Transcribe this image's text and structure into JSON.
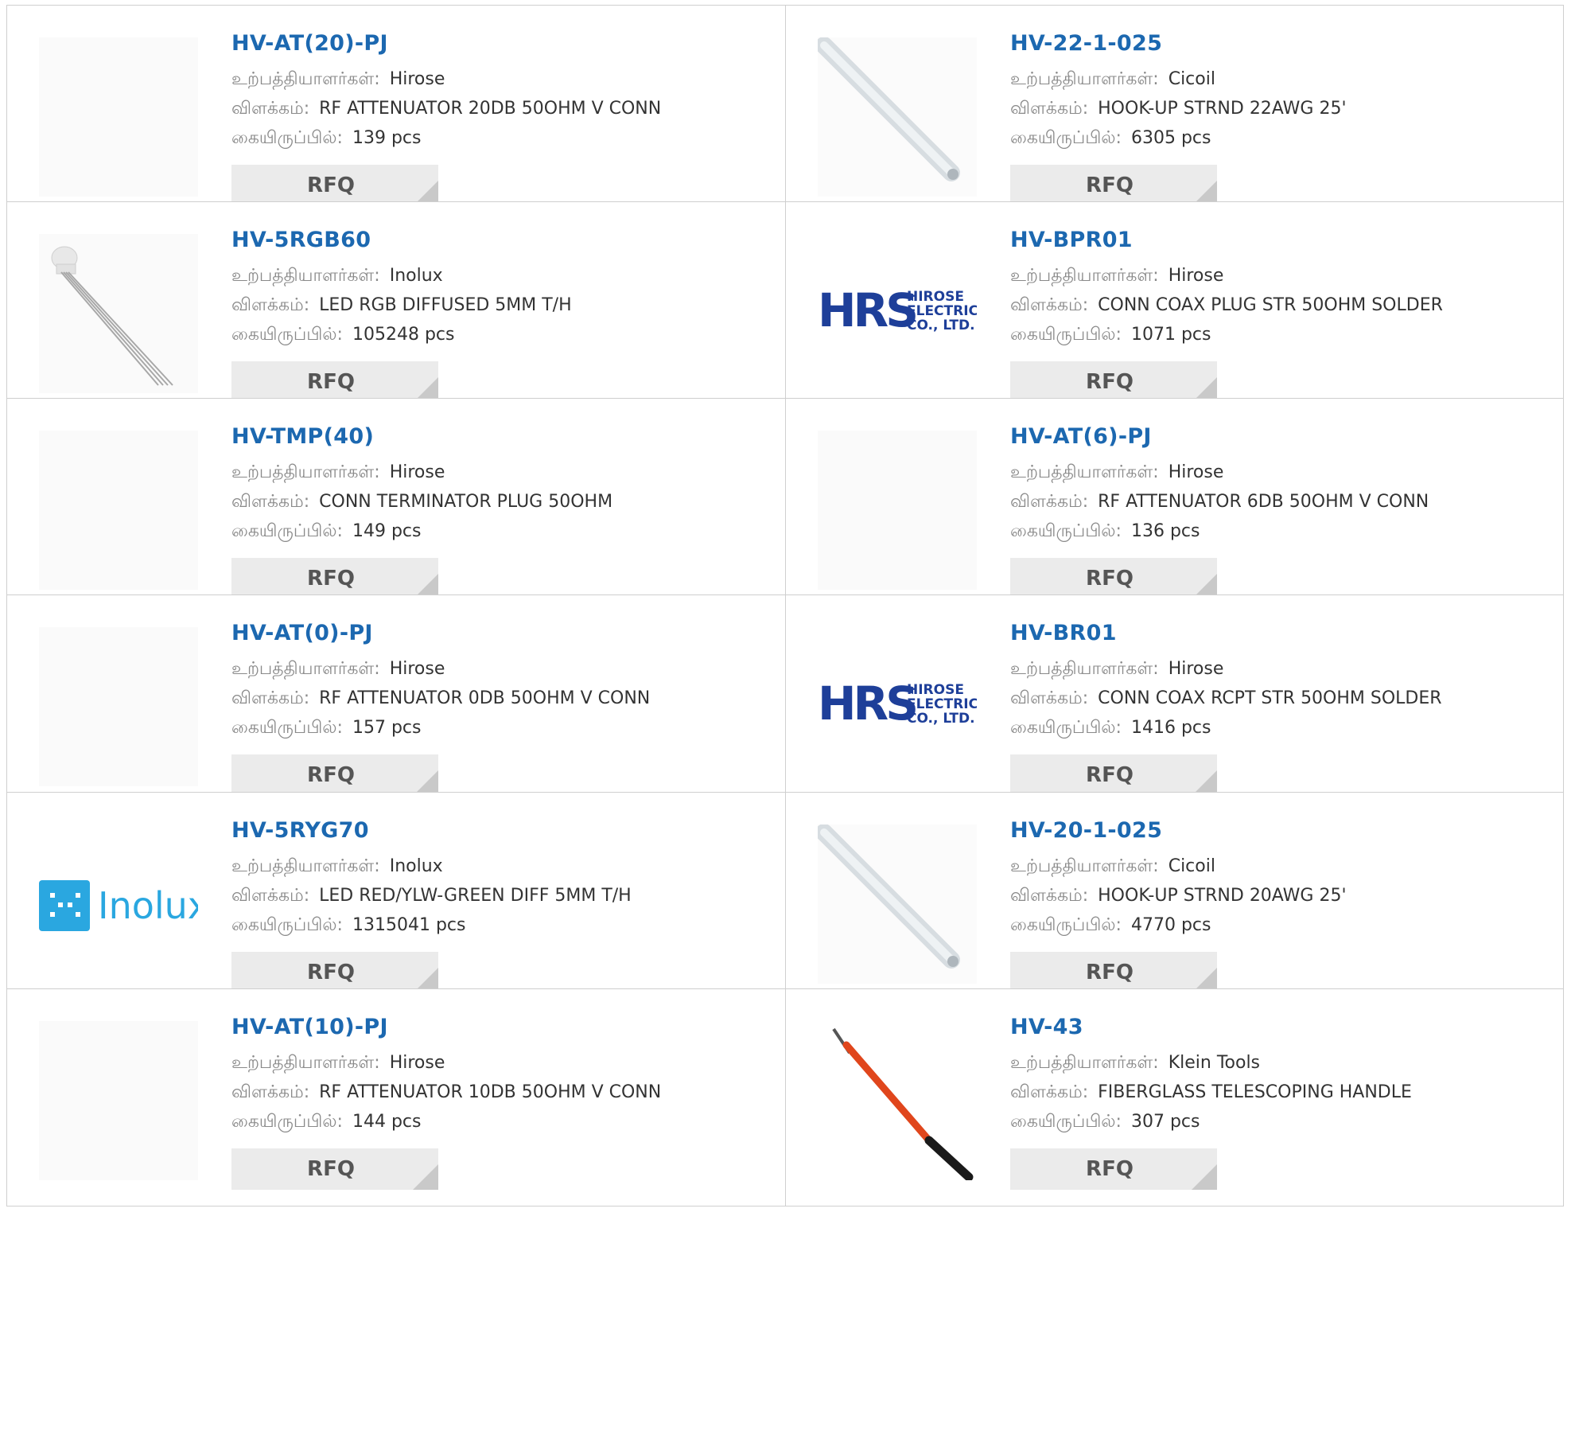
{
  "labels": {
    "manufacturer": "உற்பத்தியாளர்கள்:",
    "description": "விளக்கம்:",
    "stock": "கையிருப்பில்:",
    "rfq": "RFQ"
  },
  "products": [
    {
      "part": "HV-AT(20)-PJ",
      "manufacturer": "Hirose",
      "description": "RF ATTENUATOR 20DB 50OHM V CONN",
      "stock": "139 pcs",
      "image": "attenuator-image"
    },
    {
      "part": "HV-22-1-025",
      "manufacturer": "Cicoil",
      "description": "HOOK-UP STRND 22AWG 25'",
      "stock": "6305 pcs",
      "image": "wire-image"
    },
    {
      "part": "HV-5RGB60",
      "manufacturer": "Inolux",
      "description": "LED RGB DIFFUSED 5MM T/H",
      "stock": "105248 pcs",
      "image": "led-image"
    },
    {
      "part": "HV-BPR01",
      "manufacturer": "Hirose",
      "description": "CONN COAX PLUG STR 50OHM SOLDER",
      "stock": "1071 pcs",
      "image": "hrs-logo"
    },
    {
      "part": "HV-TMP(40)",
      "manufacturer": "Hirose",
      "description": "CONN TERMINATOR PLUG 50OHM",
      "stock": "149 pcs",
      "image": "terminator-image"
    },
    {
      "part": "HV-AT(6)-PJ",
      "manufacturer": "Hirose",
      "description": "RF ATTENUATOR 6DB 50OHM V CONN",
      "stock": "136 pcs",
      "image": "attenuator-image"
    },
    {
      "part": "HV-AT(0)-PJ",
      "manufacturer": "Hirose",
      "description": "RF ATTENUATOR 0DB 50OHM V CONN",
      "stock": "157 pcs",
      "image": "attenuator-image"
    },
    {
      "part": "HV-BR01",
      "manufacturer": "Hirose",
      "description": "CONN COAX RCPT STR 50OHM SOLDER",
      "stock": "1416 pcs",
      "image": "hrs-logo"
    },
    {
      "part": "HV-5RYG70",
      "manufacturer": "Inolux",
      "description": "LED RED/YLW-GREEN DIFF 5MM T/H",
      "stock": "1315041 pcs",
      "image": "inolux-logo"
    },
    {
      "part": "HV-20-1-025",
      "manufacturer": "Cicoil",
      "description": "HOOK-UP STRND 20AWG 25'",
      "stock": "4770 pcs",
      "image": "wire-image"
    },
    {
      "part": "HV-AT(10)-PJ",
      "manufacturer": "Hirose",
      "description": "RF ATTENUATOR 10DB 50OHM V CONN",
      "stock": "144 pcs",
      "image": "attenuator-image"
    },
    {
      "part": "HV-43",
      "manufacturer": "Klein Tools",
      "description": "FIBERGLASS TELESCOPING HANDLE",
      "stock": "307 pcs",
      "image": "handle-image"
    }
  ],
  "logos": {
    "hrs": {
      "mark": "HRS",
      "line1": "HIROSE",
      "line2": "ELECTRIC",
      "line3": "CO., LTD."
    },
    "inolux": {
      "name": "Inolux"
    }
  },
  "colors": {
    "title": "#1c68b0",
    "label": "#8a8a8a",
    "value": "#333333",
    "rfq_bg": "#ebebeb",
    "border": "#cfcfcf",
    "hrs_blue": "#1e3f99",
    "inolux_blue": "#2aa7e0"
  }
}
